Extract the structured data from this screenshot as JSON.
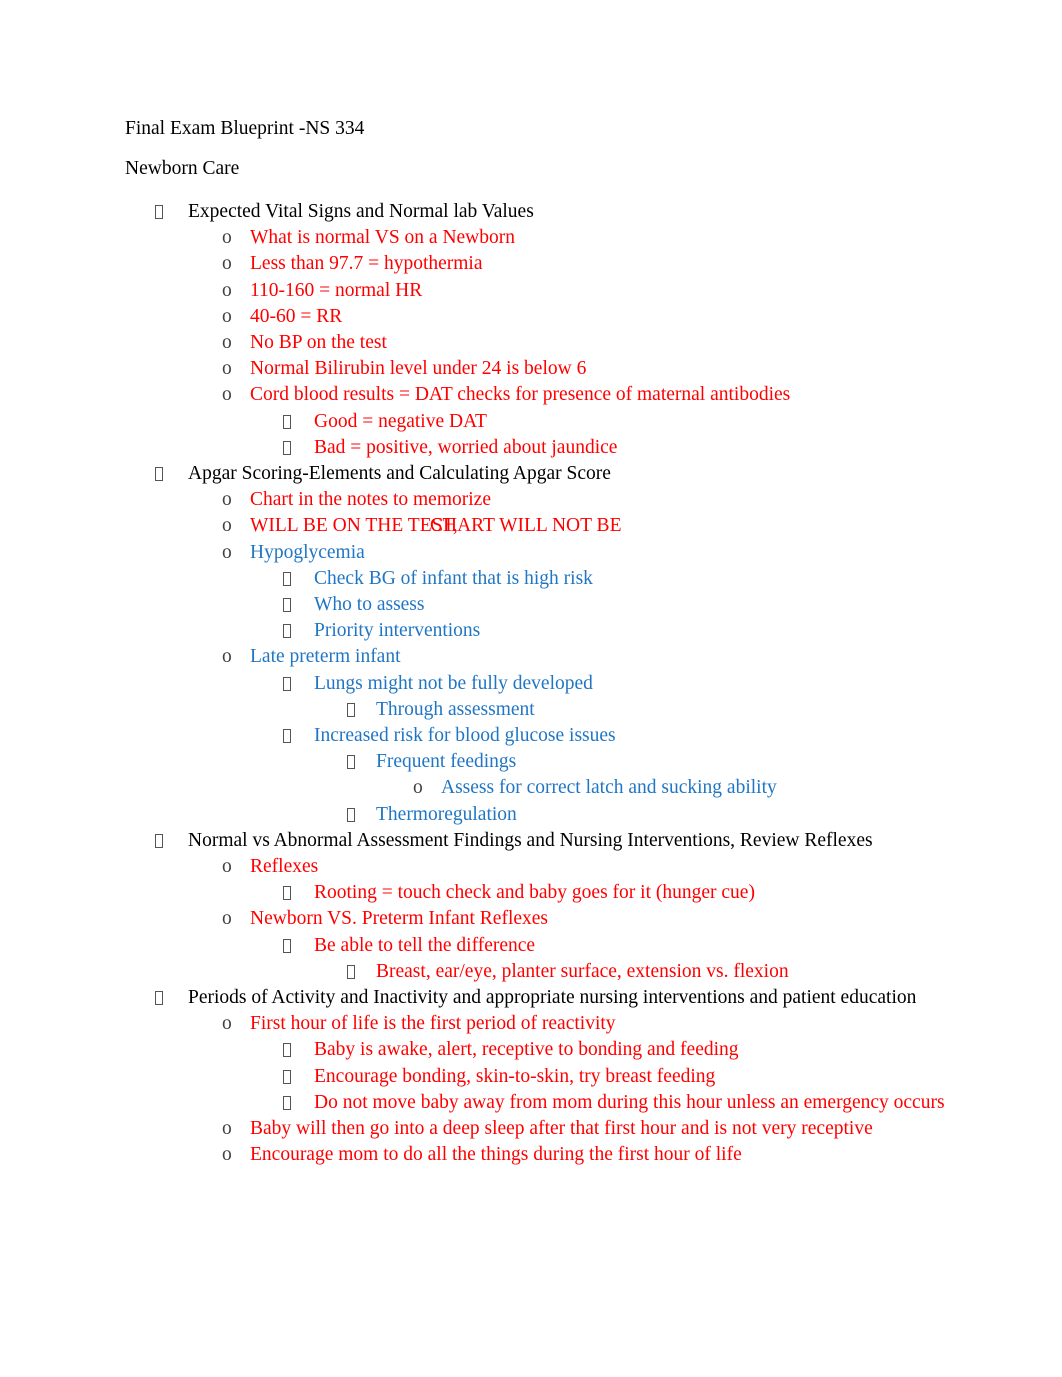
{
  "document": {
    "title": "Final Exam Blueprint -NS 334",
    "section_heading": "Newborn Care",
    "colors": {
      "black": "#000000",
      "red": "#FF0000",
      "blue": "#2076C4",
      "page_background": "#FFFFFF"
    },
    "bullet_glyphs": {
      "level1": "tofu-box-glyph",
      "level2": "o",
      "level3": "tofu-box-glyph",
      "level4": "tofu-box-glyph",
      "level5": "o"
    }
  },
  "outline": [
    {
      "level": 1,
      "color": "black",
      "text": "Expected Vital Signs and Normal lab Values"
    },
    {
      "level": 2,
      "color": "red",
      "text": "What is normal VS on a Newborn"
    },
    {
      "level": 2,
      "color": "red",
      "text": "Less than 97.7 = hypothermia"
    },
    {
      "level": 2,
      "color": "red",
      "text": "110-160 = normal HR"
    },
    {
      "level": 2,
      "color": "red",
      "text": "40-60 = RR"
    },
    {
      "level": 2,
      "color": "red",
      "text": "No BP on the test"
    },
    {
      "level": 2,
      "color": "red",
      "text": "Normal Bilirubin level under 24 is below 6"
    },
    {
      "level": 2,
      "color": "red",
      "text": "Cord blood results = DAT checks for presence of maternal antibodies"
    },
    {
      "level": 3,
      "color": "red",
      "text": "Good = negative DAT"
    },
    {
      "level": 3,
      "color": "red",
      "text": "Bad = positive, worried about jaundice"
    },
    {
      "level": 1,
      "color": "black",
      "text": "Apgar Scoring-Elements and Calculating Apgar Score"
    },
    {
      "level": 2,
      "color": "red",
      "text": "Chart in the notes to memorize"
    },
    {
      "level": 2,
      "color": "red",
      "overlapping": true,
      "text_run_a": "WILL BE ON THE TEST,",
      "text_run_b": "CHART WILL NOT BE"
    },
    {
      "level": 2,
      "color": "blue",
      "text": "Hypoglycemia"
    },
    {
      "level": 3,
      "color": "blue",
      "text": "Check BG of infant that is high risk"
    },
    {
      "level": 3,
      "color": "blue",
      "text": "Who to assess"
    },
    {
      "level": 3,
      "color": "blue",
      "text": "Priority interventions"
    },
    {
      "level": 2,
      "color": "blue",
      "text": "Late preterm infant"
    },
    {
      "level": 3,
      "color": "blue",
      "text": "Lungs might not be fully developed"
    },
    {
      "level": 4,
      "color": "blue",
      "text": "Through assessment"
    },
    {
      "level": 3,
      "color": "blue",
      "text": "Increased risk for blood glucose issues"
    },
    {
      "level": 4,
      "color": "blue",
      "text": "Frequent feedings"
    },
    {
      "level": 5,
      "color": "blue",
      "text": "Assess for correct latch and sucking ability"
    },
    {
      "level": 4,
      "color": "blue",
      "text": "Thermoregulation"
    },
    {
      "level": 1,
      "color": "black",
      "text": "Normal vs Abnormal Assessment Findings and Nursing Interventions, Review Reflexes"
    },
    {
      "level": 2,
      "color": "red",
      "text": "Reflexes"
    },
    {
      "level": 3,
      "color": "red",
      "text": "Rooting = touch check and baby goes for it (hunger cue)"
    },
    {
      "level": 2,
      "color": "red",
      "text": "Newborn VS. Preterm Infant Reflexes"
    },
    {
      "level": 3,
      "color": "red",
      "text": "Be able to tell the difference"
    },
    {
      "level": 4,
      "color": "red",
      "text": "Breast, ear/eye, planter surface, extension vs. flexion"
    },
    {
      "level": 1,
      "color": "black",
      "text": "Periods of Activity and Inactivity and appropriate nursing interventions and patient education"
    },
    {
      "level": 2,
      "color": "red",
      "text": "First hour of life is the first period of reactivity"
    },
    {
      "level": 3,
      "color": "red",
      "text": "Baby is awake, alert, receptive to bonding and feeding"
    },
    {
      "level": 3,
      "color": "red",
      "text": "Encourage bonding, skin-to-skin, try breast feeding"
    },
    {
      "level": 3,
      "color": "red",
      "text": "Do not move baby away from mom during this hour unless an emergency occurs"
    },
    {
      "level": 2,
      "color": "red",
      "text": "Baby will then go into a deep sleep after that first hour and is not very receptive"
    },
    {
      "level": 2,
      "color": "red",
      "text": "Encourage mom to do all the things during the first hour of life"
    }
  ]
}
